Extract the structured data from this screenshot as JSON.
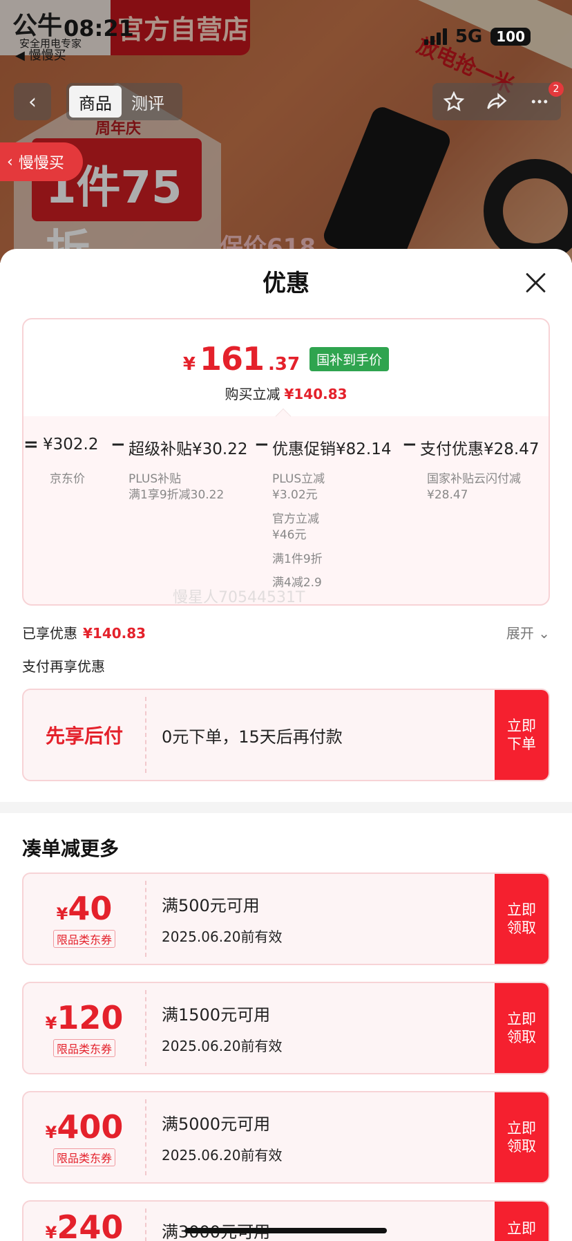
{
  "status": {
    "time": "08:21",
    "network": "5G",
    "battery": "100",
    "back_app": "◀ 慢慢买"
  },
  "background": {
    "brand_store": "官方自营店",
    "brand_logo": "公牛",
    "brand_sub": "安全用电专家",
    "anniversary": "周年庆",
    "promo_big": "1件75折",
    "banner_right": "放电抢一米",
    "protect": "保价618"
  },
  "nav": {
    "back": "‹",
    "tabs": [
      {
        "label": "商品"
      },
      {
        "label": "测评"
      }
    ],
    "star_icon": "star-icon",
    "share_icon": "share-icon",
    "more_icon": "more-icon",
    "more_badge": "2",
    "slow_buy": "慢慢买"
  },
  "sheet": {
    "title": "优惠",
    "price": {
      "yen": "¥",
      "int": "161",
      "dec": ".37",
      "tag": "国补到手价"
    },
    "reduce_label": "购买立减",
    "reduce_value": "¥140.83",
    "formula": {
      "eq": "=",
      "base": {
        "label": "¥302.2",
        "sub": "京东价"
      },
      "op1": "−",
      "super": {
        "label": "超级补贴¥30.22",
        "sub1": "PLUS补贴",
        "sub2": "满1享9折减30.22"
      },
      "op2": "−",
      "promo": {
        "label": "优惠促销¥82.14",
        "sub": [
          "PLUS立减",
          "¥3.02元",
          "官方立减",
          "¥46元",
          "满1件9折",
          "满4减2.9"
        ]
      },
      "op3": "−",
      "pay": {
        "label": "支付优惠¥28.47",
        "sub1": "国家补贴云闪付减",
        "sub2": "¥28.47"
      }
    },
    "watermark": "慢星人70544531T",
    "enjoyed_label": "已享优惠",
    "enjoyed_value": "¥140.83",
    "expand": "展开",
    "pay_more": "支付再享优惠",
    "bnpl": {
      "title": "先享后付",
      "desc": "0元下单，15天后再付款",
      "button": "立即下单"
    },
    "combine_title": "凑单减更多",
    "coupons": [
      {
        "yen": "¥",
        "amount": "40",
        "limit": "限品类东券",
        "condition": "满500元可用",
        "date": "2025.06.20前有效",
        "button": "立即领取"
      },
      {
        "yen": "¥",
        "amount": "120",
        "limit": "限品类东券",
        "condition": "满1500元可用",
        "date": "2025.06.20前有效",
        "button": "立即领取"
      },
      {
        "yen": "¥",
        "amount": "400",
        "limit": "限品类东券",
        "condition": "满5000元可用",
        "date": "2025.06.20前有效",
        "button": "立即领取"
      },
      {
        "yen": "¥",
        "amount": "240",
        "limit": "",
        "condition": "满3000元可用",
        "date": "",
        "button": "立即"
      }
    ]
  },
  "colors": {
    "accent_red": "#e4212b",
    "button_red": "#f5202f",
    "tag_green": "#2fa44f"
  }
}
